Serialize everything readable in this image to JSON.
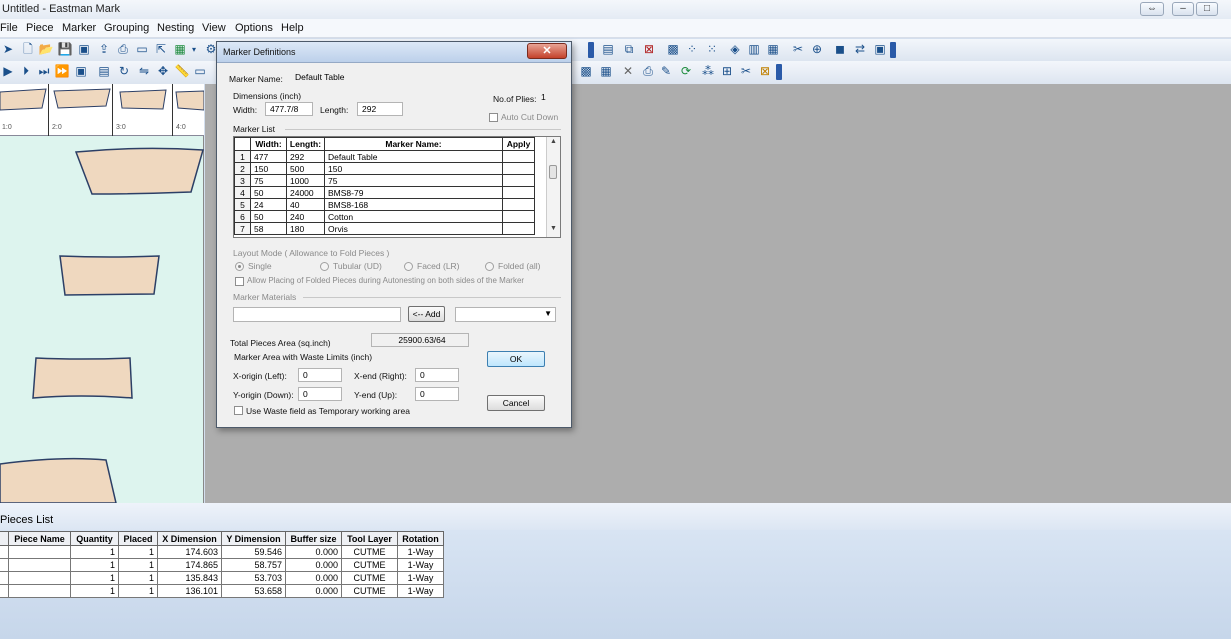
{
  "window": {
    "title": "Untitled - Eastman Mark"
  },
  "menu": [
    "File",
    "Piece",
    "Marker",
    "Grouping",
    "Nesting",
    "View",
    "Options",
    "Help"
  ],
  "ruler_labels": [
    "1:0",
    "2:0",
    "3:0",
    "4:0"
  ],
  "dialog": {
    "title": "Marker Definitions",
    "close_glyph": "✕",
    "marker_name_label": "Marker Name:",
    "marker_name_value": "Default Table",
    "dimensions_label": "Dimensions (inch)",
    "width_label": "Width:",
    "width_value": "477.7/8",
    "length_label": "Length:",
    "length_value": "292",
    "plies_label": "No.of Plies:",
    "plies_value": "1",
    "auto_cut_label": "Auto Cut Down",
    "marker_list_label": "Marker List",
    "columns": [
      "Width:",
      "Length:",
      "Marker Name:",
      "Apply"
    ],
    "rows": [
      {
        "idx": "1",
        "width": "477",
        "length": "292",
        "name": "Default Table"
      },
      {
        "idx": "2",
        "width": "150",
        "length": "500",
        "name": "150"
      },
      {
        "idx": "3",
        "width": "75",
        "length": "1000",
        "name": "75"
      },
      {
        "idx": "4",
        "width": "50",
        "length": "24000",
        "name": "BMS8-79"
      },
      {
        "idx": "5",
        "width": "24",
        "length": "40",
        "name": "BMS8-168"
      },
      {
        "idx": "6",
        "width": "50",
        "length": "240",
        "name": "Cotton"
      },
      {
        "idx": "7",
        "width": "58",
        "length": "180",
        "name": "Orvis"
      }
    ],
    "layout_mode_label": "Layout Mode ( Allowance to Fold Pieces )",
    "layout_options": [
      "Single",
      "Tubular (UD)",
      "Faced (LR)",
      "Folded (all)"
    ],
    "allow_folded_label": "Allow Placing of Folded Pieces during Autonesting on both sides of the Marker",
    "marker_materials_label": "Marker Materials",
    "add_button": "<-- Add",
    "total_area_label": "Total Pieces Area (sq.inch)",
    "total_area_value": "25900.63/64",
    "waste_limits_label": "Marker Area with Waste Limits (inch)",
    "x_origin_label": "X-origin (Left):",
    "x_origin_value": "0",
    "x_end_label": "X-end (Right):",
    "x_end_value": "0",
    "y_origin_label": "Y-origin (Down):",
    "y_origin_value": "0",
    "y_end_label": "Y-end (Up):",
    "y_end_value": "0",
    "use_waste_label": "Use Waste field as Temporary working area",
    "ok_button": "OK",
    "cancel_button": "Cancel"
  },
  "pieces_list": {
    "title": "Pieces List",
    "columns": [
      "Piece Name",
      "Quantity",
      "Placed",
      "X Dimension",
      "Y Dimension",
      "Buffer size",
      "Tool Layer",
      "Rotation"
    ],
    "rows": [
      {
        "name": "",
        "qty": "1",
        "placed": "1",
        "x": "174.603",
        "y": "59.546",
        "buffer": "0.000",
        "tool": "CUTME",
        "rot": "1-Way"
      },
      {
        "name": "",
        "qty": "1",
        "placed": "1",
        "x": "174.865",
        "y": "58.757",
        "buffer": "0.000",
        "tool": "CUTME",
        "rot": "1-Way"
      },
      {
        "name": "",
        "qty": "1",
        "placed": "1",
        "x": "135.843",
        "y": "53.703",
        "buffer": "0.000",
        "tool": "CUTME",
        "rot": "1-Way"
      },
      {
        "name": "",
        "qty": "1",
        "placed": "1",
        "x": "136.101",
        "y": "53.658",
        "buffer": "0.000",
        "tool": "CUTME",
        "rot": "1-Way"
      }
    ]
  },
  "colors": {
    "workarea": "#ddf4ee",
    "piece_fill": "#efd8bf",
    "piece_stroke": "#2c3f66",
    "canvas_gray": "#adadad",
    "toolbar_accent": "#2a5aa8"
  }
}
